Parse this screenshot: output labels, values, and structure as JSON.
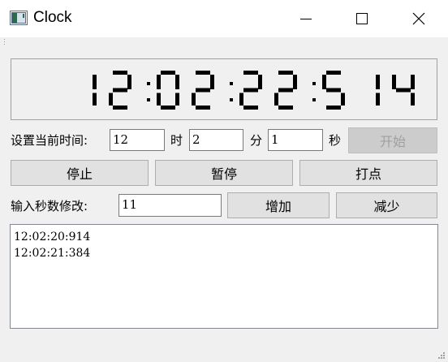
{
  "window": {
    "title": "Clock",
    "icon": "app-window-icon"
  },
  "display": {
    "time": "12:02:22:514"
  },
  "set_time": {
    "label": "设置当前时间:",
    "hour_value": "12",
    "hour_unit": "时",
    "minute_value": "2",
    "minute_unit": "分",
    "second_value": "1",
    "second_unit": "秒",
    "start_label": "开始"
  },
  "controls": {
    "stop_label": "停止",
    "pause_label": "暂停",
    "mark_label": "打点"
  },
  "adjust": {
    "label": "输入秒数修改:",
    "value": "11",
    "increase_label": "增加",
    "decrease_label": "减少"
  },
  "log": {
    "lines": [
      "12:02:20:914",
      "12:02:21:384"
    ]
  }
}
